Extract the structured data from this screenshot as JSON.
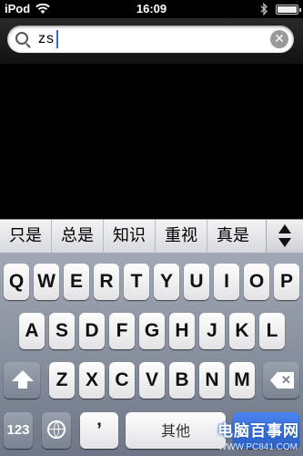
{
  "status_bar": {
    "carrier": "iPod",
    "time": "16:09"
  },
  "search": {
    "query": "zs",
    "clear_icon": "clear-icon"
  },
  "candidates": [
    "只是",
    "总是",
    "知识",
    "重视",
    "真是"
  ],
  "keyboard": {
    "row1": [
      "Q",
      "W",
      "E",
      "R",
      "T",
      "Y",
      "U",
      "I",
      "O",
      "P"
    ],
    "row2": [
      "A",
      "S",
      "D",
      "F",
      "G",
      "H",
      "J",
      "K",
      "L"
    ],
    "row3": [
      "Z",
      "X",
      "C",
      "V",
      "B",
      "N",
      "M"
    ],
    "numbers_label": "123",
    "punct_label": "’",
    "space_label": "其他"
  },
  "watermark": {
    "title": "电脑百事网",
    "url": "WWW.PC841.COM"
  }
}
